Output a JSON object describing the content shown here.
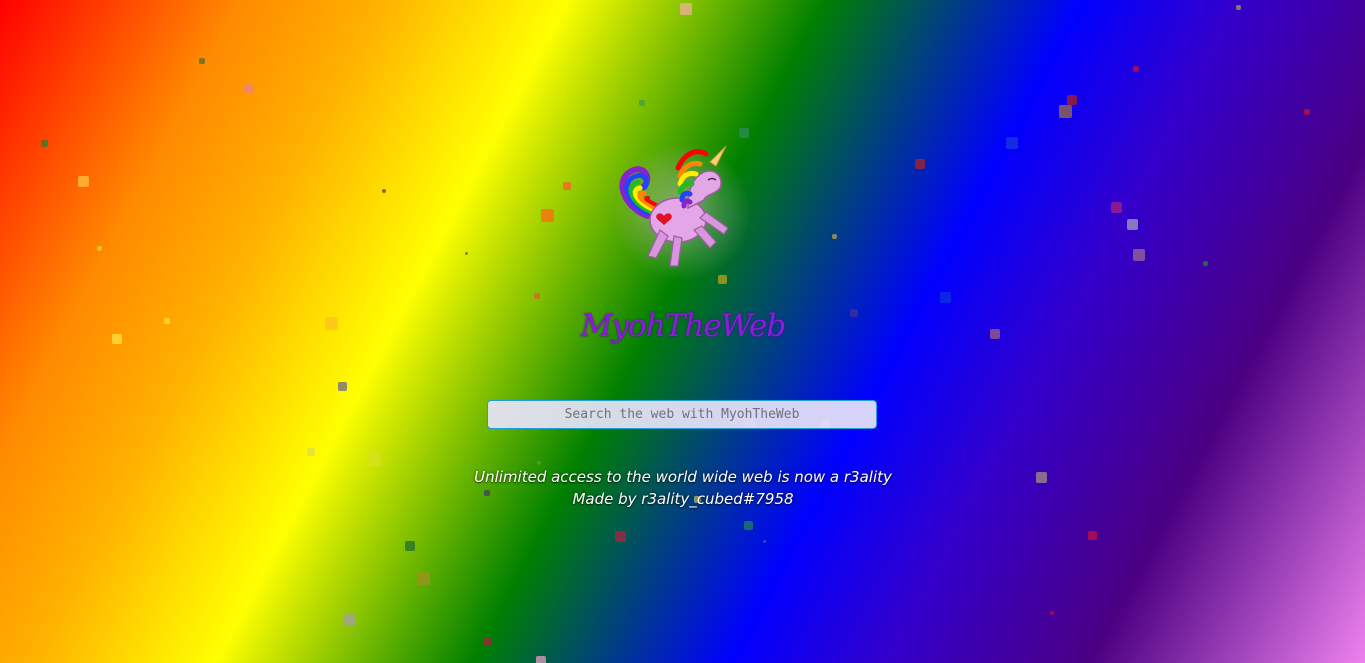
{
  "logo": {
    "icon": "unicorn-icon",
    "colors": {
      "body": "#e3a6e6",
      "mane": [
        "#ff0000",
        "#ff8800",
        "#ffee00",
        "#22bb22",
        "#2244ff",
        "#8822cc"
      ],
      "heart": "#e0102a",
      "horn": "#f4d27a"
    }
  },
  "site": {
    "title": "MyohTheWeb"
  },
  "search": {
    "placeholder": "Search the web with MyohTheWeb",
    "value": ""
  },
  "footer": {
    "tagline": "Unlimited access to the world wide web is now a r3ality",
    "credit": "Made by r3ality_cubed#7958"
  },
  "theme": {
    "gradient": [
      "#ff0000",
      "#ff8a00",
      "#ffff00",
      "#008000",
      "#0000ff",
      "#4b0082",
      "#ee82ee"
    ],
    "title_color": "#8b1cd8",
    "search_border": "#1f9ed8"
  }
}
